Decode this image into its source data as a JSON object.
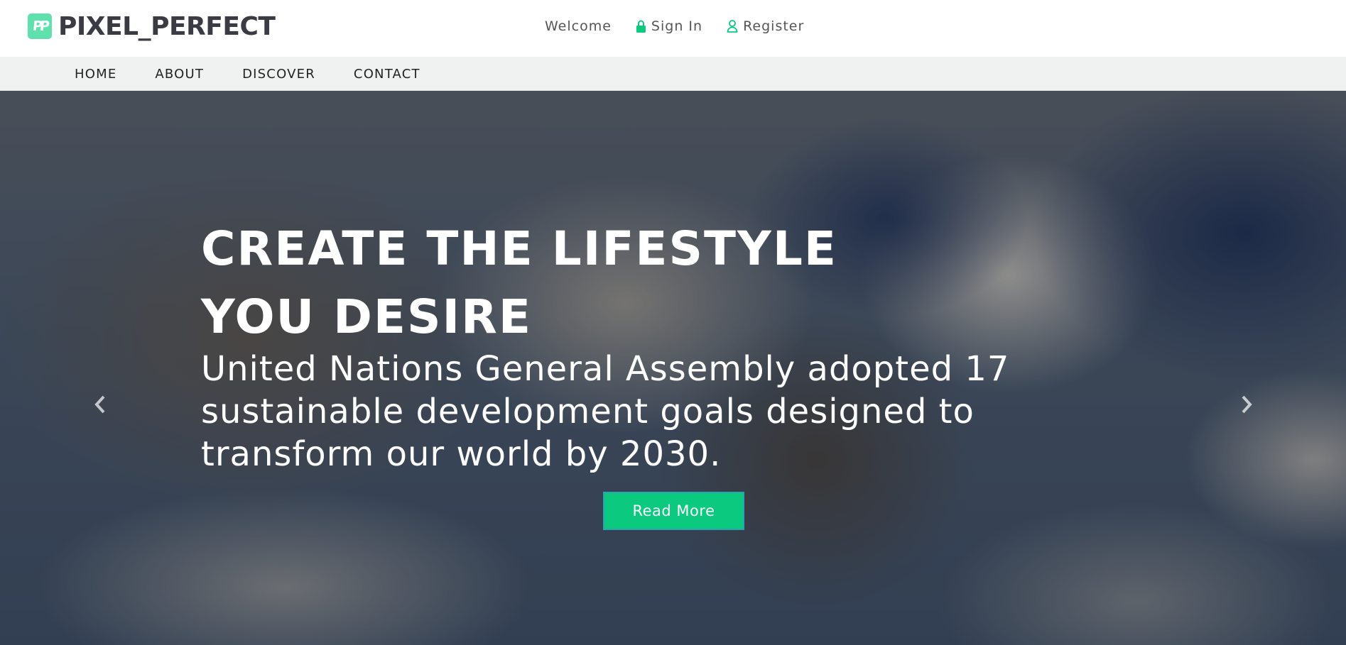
{
  "brand": {
    "logo_text": "PIXEL_PERFECT",
    "logo_mark": "PP",
    "accent_color": "#5fe0ad"
  },
  "topnav": {
    "welcome": "Welcome",
    "sign_in": "Sign In",
    "register": "Register",
    "icon_color": "#0bc97f"
  },
  "mainnav": {
    "items": [
      {
        "label": "HOME"
      },
      {
        "label": "ABOUT"
      },
      {
        "label": "DISCOVER"
      },
      {
        "label": "CONTACT"
      }
    ]
  },
  "hero": {
    "title_line1": "CREATE THE LIFESTYLE",
    "title_line2": "YOU DESIRE",
    "subtitle": "United Nations General Assembly adopted 17 sustainable development goals designed to transform our world by 2030.",
    "cta_label": "Read More",
    "cta_color": "#0bc97f",
    "prev_icon": "chevron-left-icon",
    "next_icon": "chevron-right-icon"
  }
}
